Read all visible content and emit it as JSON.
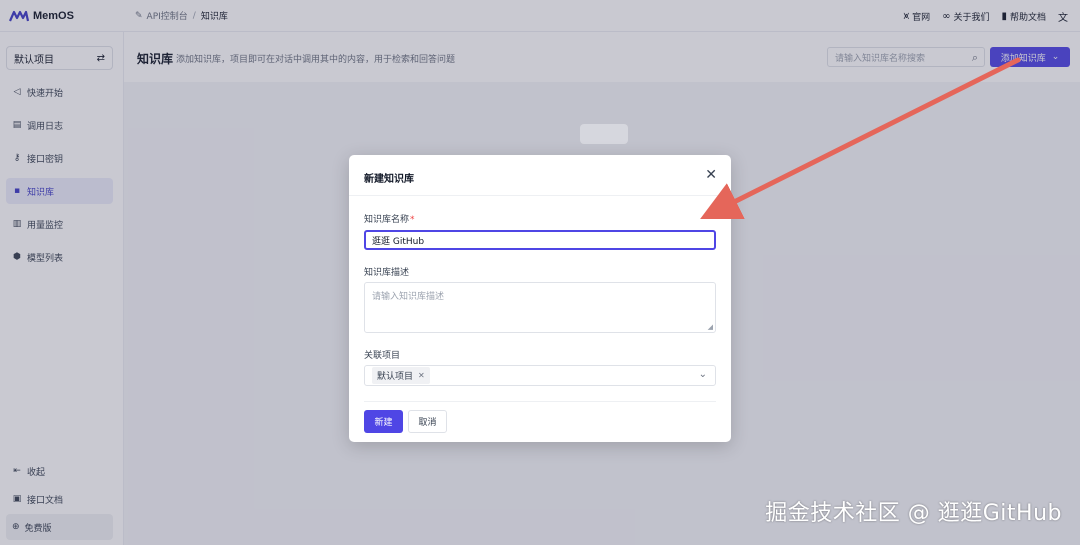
{
  "app": {
    "name": "MemOS",
    "logo_icon": "memos-logo-icon"
  },
  "breadcrumb": {
    "icon": "pen-icon",
    "parent": "API控制台",
    "separator": "/",
    "current": "知识库"
  },
  "topnav": [
    {
      "icon": "memos-logo-icon",
      "glyph": "⩙",
      "label": "官网"
    },
    {
      "icon": "infinity-icon",
      "glyph": "∞",
      "label": "关于我们"
    },
    {
      "icon": "book-icon",
      "glyph": "▮",
      "label": "帮助文档"
    },
    {
      "icon": "translate-icon",
      "glyph": "文",
      "label": ""
    }
  ],
  "sidebar": {
    "project_label": "默认项目",
    "switch_icon": "switch-icon",
    "items": [
      {
        "icon": "send-icon",
        "glyph": "◁",
        "label": "快速开始"
      },
      {
        "icon": "log-icon",
        "glyph": "▤",
        "label": "调用日志"
      },
      {
        "icon": "key-icon",
        "glyph": "⚷",
        "label": "接口密钥"
      },
      {
        "icon": "database-icon",
        "glyph": "▪",
        "label": "知识库",
        "active": true
      },
      {
        "icon": "bar-chart-icon",
        "glyph": "▥",
        "label": "用量监控"
      },
      {
        "icon": "cube-icon",
        "glyph": "⬢",
        "label": "模型列表"
      }
    ],
    "collapse_label": "收起",
    "api_docs_label": "接口文档",
    "plan_label": "免费版"
  },
  "main": {
    "title": "知识库",
    "description": "添加知识库，项目即可在对话中调用其中的内容，用于检索和回答问题",
    "search_placeholder": "请输入知识库名称搜索",
    "add_button_label": "添加知识库"
  },
  "modal": {
    "title": "新建知识库",
    "name_label": "知识库名称",
    "required_mark": "*",
    "name_value": "逛逛 GitHub",
    "desc_label": "知识库描述",
    "desc_placeholder": "请输入知识库描述",
    "project_label": "关联项目",
    "project_tag": "默认项目",
    "create_label": "新建",
    "cancel_label": "取消"
  },
  "watermark": "掘金技术社区 @ 逛逛GitHub",
  "colors": {
    "accent": "#4f46e5",
    "arrow": "#e5665a"
  }
}
